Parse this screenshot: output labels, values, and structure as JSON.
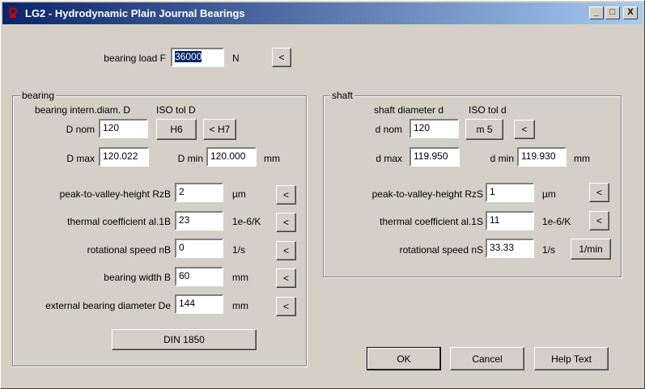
{
  "window": {
    "title": "LG2 - Hydrodynamic Plain Journal Bearings",
    "controls": {
      "minimize": "_",
      "maximize": "□",
      "close": "X"
    }
  },
  "load": {
    "label": "bearing load F",
    "value": "36000",
    "unit": "N",
    "arrow": "<"
  },
  "bearing": {
    "group_title": "bearing",
    "diam_header": "bearing intern.diam. D",
    "iso_header": "ISO tol D",
    "dnom_label": "D nom",
    "dnom_value": "120",
    "tol_button": "H6",
    "tol_prev_button": "< H7",
    "dmax_label": "D max",
    "dmax_value": "120.022",
    "dmin_label": "D min",
    "dmin_value": "120.000",
    "d_unit": "mm",
    "params": [
      {
        "label": "peak-to-valley-height RzB",
        "value": "2",
        "unit": "µm",
        "arrow": "<"
      },
      {
        "label": "thermal coefficient al.1B",
        "value": "23",
        "unit": "1e-6/K",
        "arrow": "<"
      },
      {
        "label": "rotational speed nB",
        "value": "0",
        "unit": "1/s",
        "arrow": "<"
      },
      {
        "label": "bearing width B",
        "value": "60",
        "unit": "mm",
        "arrow": "<"
      },
      {
        "label": "external bearing diameter De",
        "value": "144",
        "unit": "mm",
        "arrow": "<"
      }
    ],
    "din_button": "DIN 1850"
  },
  "shaft": {
    "group_title": "shaft",
    "diam_header": "shaft diameter d",
    "iso_header": "ISO tol d",
    "dnom_label": "d nom",
    "dnom_value": "120",
    "tol_button": "m 5",
    "tol_prev_button": "<",
    "dmax_label": "d max",
    "dmax_value": "119.950",
    "dmin_label": "d min",
    "dmin_value": "119.930",
    "d_unit": "mm",
    "params": [
      {
        "label": "peak-to-valley-height RzS",
        "value": "1",
        "unit": "µm",
        "arrow": "<"
      },
      {
        "label": "thermal coefficient al.1S",
        "value": "11",
        "unit": "1e-6/K",
        "arrow": "<"
      },
      {
        "label": "rotational speed nS",
        "value": "33.33",
        "unit": "1/s",
        "arrow": "1/min"
      }
    ]
  },
  "actions": {
    "ok": "OK",
    "cancel": "Cancel",
    "help": "Help Text"
  },
  "colors": {
    "titlebar_start": "#0a246a",
    "titlebar_end": "#a6caf0",
    "face": "#d4d0c8",
    "icon_red": "#cc0000"
  }
}
